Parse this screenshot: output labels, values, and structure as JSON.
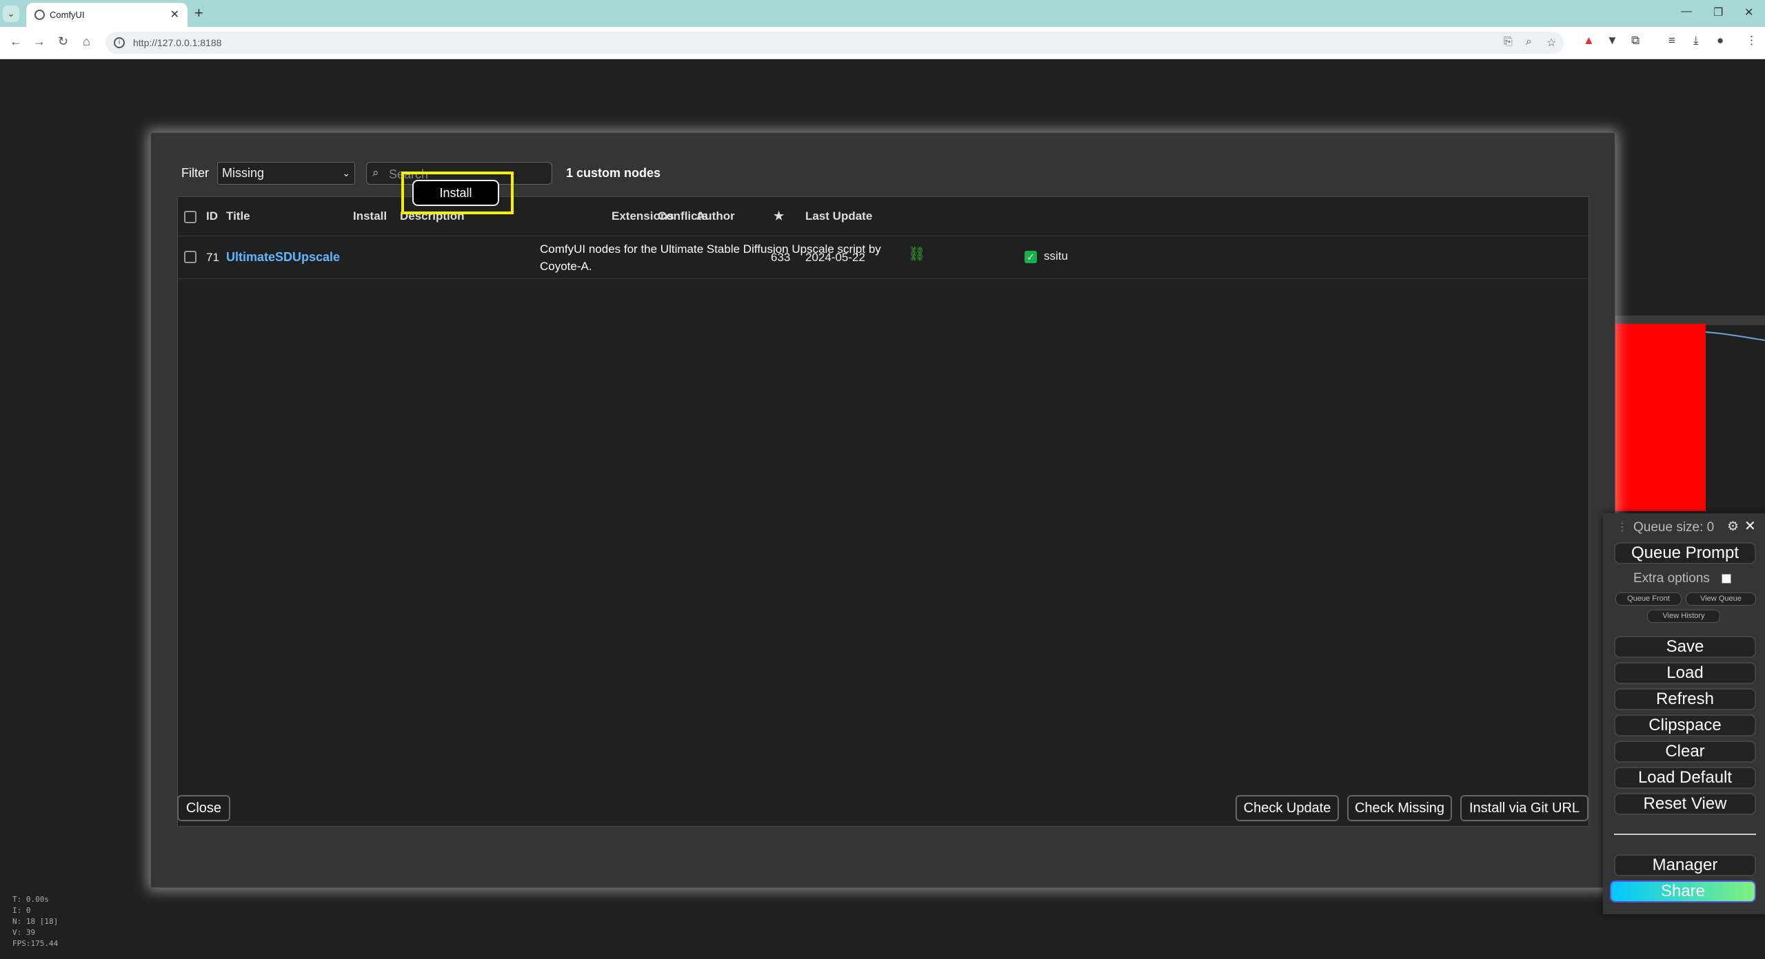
{
  "browser": {
    "tab_title": "ComfyUI",
    "url": "http://127.0.0.1:8188",
    "icons": [
      "tab-dropdown-icon",
      "close-tab-icon",
      "new-tab-icon",
      "back-icon",
      "forward-icon",
      "reload-icon",
      "home-icon",
      "site-info-icon",
      "translate-icon",
      "zoom-icon",
      "bookmark-star-icon",
      "extension-icon",
      "downloads-icon",
      "profile-icon",
      "menu-icon"
    ]
  },
  "stats": {
    "t": "T: 0.00s",
    "i": "I: 0",
    "n": "N: 18 [18]",
    "v": "V: 39",
    "fps": "FPS:175.44"
  },
  "dialog": {
    "filter_label": "Filter",
    "filter_value": "Missing",
    "search_placeholder": "Search",
    "node_count": "1 custom nodes",
    "columns": {
      "id": "ID",
      "title": "Title",
      "install": "Install",
      "description": "Description",
      "extensions": "Extensions",
      "conflicts": "Conflicts",
      "author": "Author",
      "stars": "★",
      "last_update": "Last Update"
    },
    "rows": [
      {
        "id": "71",
        "title": "UltimateSDUpscale",
        "install_label": "Install",
        "description": "ComfyUI nodes for the Ultimate Stable Diffusion Upscale script by Coyote-A.",
        "extensions_icon": "extensions-icon",
        "conflicts": "",
        "author": "ssitu",
        "stars": "633",
        "last_update": "2024-05-22"
      }
    ],
    "buttons": {
      "close": "Close",
      "check_update": "Check Update",
      "check_missing": "Check Missing",
      "install_git": "Install via Git URL"
    },
    "highlight_color": "#f4f000"
  },
  "queue_panel": {
    "queue_size": "Queue size: 0",
    "queue_prompt": "Queue Prompt",
    "extra_options": "Extra options",
    "queue_front": "Queue Front",
    "view_queue": "View Queue",
    "view_history": "View History",
    "save": "Save",
    "load": "Load",
    "refresh": "Refresh",
    "clipspace": "Clipspace",
    "clear": "Clear",
    "load_default": "Load Default",
    "reset_view": "Reset View",
    "manager": "Manager",
    "share": "Share"
  }
}
